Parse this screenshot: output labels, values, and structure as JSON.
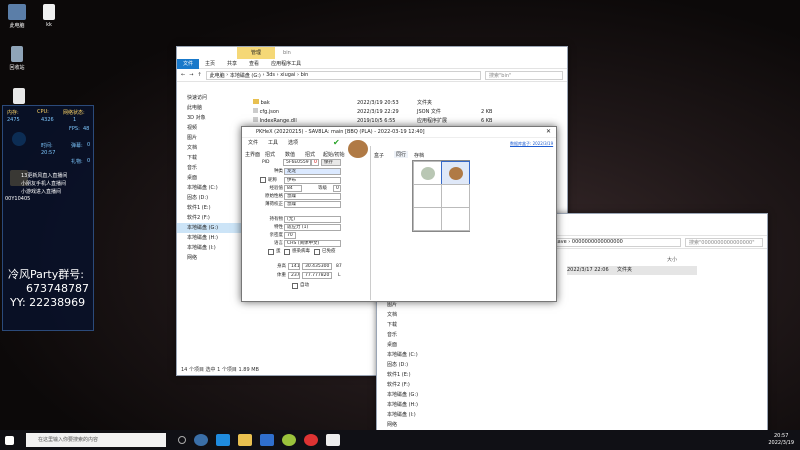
{
  "desktop": {
    "icons": [
      {
        "label": "此电脑"
      },
      {
        "label": "kk"
      },
      {
        "label": "回收站"
      },
      {
        "label": "快速访问"
      },
      {
        "label": "Microsoft Edge"
      },
      {
        "label": "新建文件夹"
      }
    ]
  },
  "overlay": {
    "stats_headers": [
      "内存:",
      "CPU:",
      "网络状态:"
    ],
    "stats_values": [
      "2475",
      "4326",
      "1"
    ],
    "fps_label": "FPS:",
    "fps_value": "48",
    "lines": [
      "13更新风直入直播间",
      "小朋友手机人直播间",
      "小游戏进入直播间"
    ],
    "time_label": "时间:",
    "time_value": "20:57",
    "count_label": "弹幕:",
    "count_value": "0",
    "gift_label": "礼物:",
    "gift_value": "0",
    "id": "00Y10405",
    "party_title": "冷风Party群号:",
    "party_number": "673748787",
    "yy": "YY: 22238969"
  },
  "explorer1": {
    "tab_manage": "管理",
    "tab_bin": "bin",
    "ribbon": [
      "文件",
      "主页",
      "共享",
      "查看",
      "应用程序工具"
    ],
    "path": [
      "此电脑",
      "本地磁盘 (G:)",
      "3ds",
      "xiugai",
      "bin"
    ],
    "search_placeholder": "搜索\"bin\"",
    "nav": [
      "快速访问",
      "此电脑",
      "3D 对象",
      "视频",
      "图片",
      "文档",
      "下载",
      "音乐",
      "桌面",
      "本地磁盘 (C:)",
      "固态 (D:)",
      "软件1 (E:)",
      "软件2 (F:)",
      "本地磁盘 (G:)",
      "本地磁盘 (H:)",
      "本地磁盘 (I:)",
      "网络"
    ],
    "files": [
      {
        "name": "bak",
        "date": "2022/3/19 20:53",
        "type": "文件夹",
        "size": ""
      },
      {
        "name": "cfg.json",
        "date": "2022/3/19 22:29",
        "type": "JSON 文件",
        "size": "2 KB"
      },
      {
        "name": "IndexRange.dll",
        "date": "2019/10/5 6:55",
        "type": "应用程序扩展",
        "size": "6 KB"
      }
    ],
    "status": "14 个项目    选中 1 个项目  1.89 MB"
  },
  "explorer2": {
    "path": [
      "save",
      "0000000000000000"
    ],
    "search_placeholder": "搜索\"0000000000000000\"",
    "file": {
      "name": "2022/3/17 22:06",
      "type": "文件夹"
    },
    "nav": [
      "图片",
      "文档",
      "下载",
      "音乐",
      "桌面",
      "本地磁盘 (C:)",
      "固态 (D:)",
      "软件1 (E:)",
      "软件2 (F:)",
      "本地磁盘 (G:)",
      "本地磁盘 (H:)",
      "本地磁盘 (I:)",
      "网络"
    ],
    "col_size": "大小"
  },
  "pkhex": {
    "title": "PKHeX (20220215) - SAV8LA: main [BBQ (PLA) - 2022-03-19 12:40]",
    "menu": [
      "文件",
      "工具",
      "选项"
    ],
    "tabs": [
      "主界面",
      "招式",
      "数值",
      "招式",
      "起始/初始"
    ],
    "pid": "PID",
    "pid_value": "5F6E0559",
    "pid_shiny": "0",
    "pid_btn": "保存",
    "species_label": "种类",
    "species_value": "龙龙",
    "nick_label": "昵称",
    "nick_value": "伊布",
    "exp_label": "经验值",
    "exp_value": "84",
    "level_label": "等级",
    "level_value": "0",
    "nature_label": "原始性格",
    "nature_value": "急躁",
    "stat_nature_label": "薄荷校正",
    "stat_nature_value": "急躁",
    "item_label": "持有物",
    "item_value": "(无)",
    "ability_label": "特性",
    "ability_value": "适应力 (1)",
    "friend_label": "亲密度",
    "friend_value": "70",
    "lang_label": "语言",
    "lang_value": "CHS (简体中文)",
    "chk_egg": "蛋",
    "chk_infected": "感染病毒",
    "chk_cured": "已免疫",
    "chk_alpha": "头目",
    "chk_shiny": "闪光",
    "height_label": "身高",
    "height_value": "141",
    "height_cm": "30.435300",
    "height_unit": "87",
    "weight_label": "体重",
    "weight_value": "237",
    "weight_kg": "77.777820",
    "weight_unit": "L",
    "auto_label": "自动",
    "box_tabs": [
      "盒子",
      "同行",
      "存档"
    ],
    "box_link": "数据库盒子: 2022/3/19"
  },
  "taskbar": {
    "search": "在这里输入你要搜索的内容",
    "time": "20:57",
    "date": "2022/3/19"
  }
}
